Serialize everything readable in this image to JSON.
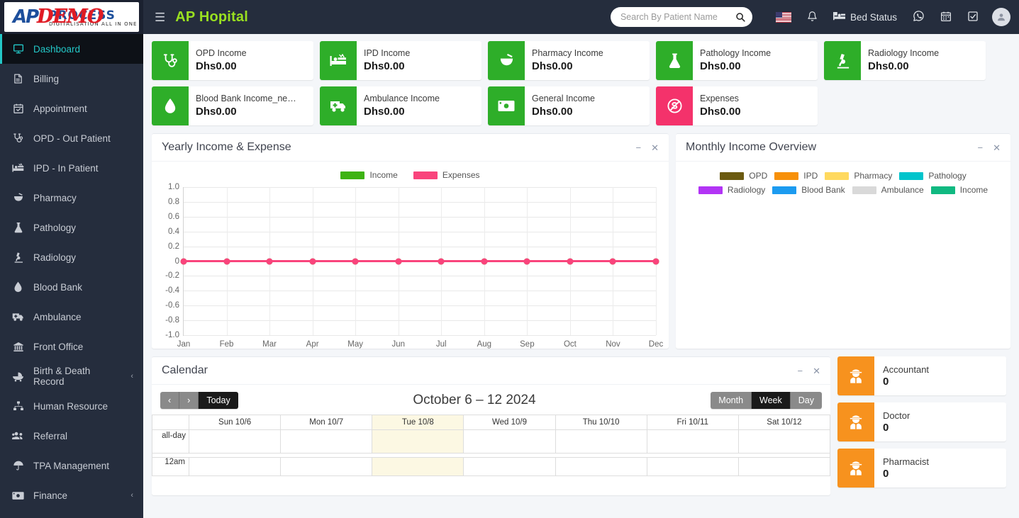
{
  "header": {
    "logo": {
      "ap": "AP",
      "process": "PROCESS",
      "subtitle": "DIGITALISATION ALL IN ONE",
      "demo": "DEMO"
    },
    "menu_toggle": "☰",
    "brand_title": "AP Hopital",
    "search": {
      "placeholder": "Search By Patient Name",
      "value": ""
    },
    "bed_status_label": "Bed Status",
    "icons": [
      "us-flag-icon",
      "bell-icon",
      "bed-icon",
      "whatsapp-icon",
      "calendar-icon",
      "checkbox-icon",
      "avatar"
    ]
  },
  "sidebar": {
    "items": [
      {
        "label": "Dashboard",
        "icon": "monitor-icon",
        "active": true,
        "chevron": ""
      },
      {
        "label": "Billing",
        "icon": "file-invoice-icon",
        "active": false,
        "chevron": ""
      },
      {
        "label": "Appointment",
        "icon": "calendar-check-icon",
        "active": false,
        "chevron": ""
      },
      {
        "label": "OPD - Out Patient",
        "icon": "stethoscope-icon",
        "active": false,
        "chevron": ""
      },
      {
        "label": "IPD - In Patient",
        "icon": "hospital-bed-icon",
        "active": false,
        "chevron": ""
      },
      {
        "label": "Pharmacy",
        "icon": "mortar-pestle-icon",
        "active": false,
        "chevron": ""
      },
      {
        "label": "Pathology",
        "icon": "flask-icon",
        "active": false,
        "chevron": ""
      },
      {
        "label": "Radiology",
        "icon": "microscope-icon",
        "active": false,
        "chevron": ""
      },
      {
        "label": "Blood Bank",
        "icon": "blood-drop-icon",
        "active": false,
        "chevron": ""
      },
      {
        "label": "Ambulance",
        "icon": "ambulance-icon",
        "active": false,
        "chevron": ""
      },
      {
        "label": "Front Office",
        "icon": "building-icon",
        "active": false,
        "chevron": ""
      },
      {
        "label": "Birth & Death Record",
        "icon": "baby-carriage-icon",
        "active": false,
        "chevron": "‹"
      },
      {
        "label": "Human Resource",
        "icon": "sitemap-icon",
        "active": false,
        "chevron": ""
      },
      {
        "label": "Referral",
        "icon": "users-icon",
        "active": false,
        "chevron": ""
      },
      {
        "label": "TPA Management",
        "icon": "umbrella-icon",
        "active": false,
        "chevron": ""
      },
      {
        "label": "Finance",
        "icon": "money-bill-icon",
        "active": false,
        "chevron": "‹"
      }
    ]
  },
  "stats": [
    {
      "label": "OPD Income",
      "value": "Dhs0.00",
      "icon": "stethoscope-icon",
      "color": "#2eae29"
    },
    {
      "label": "IPD Income",
      "value": "Dhs0.00",
      "icon": "hospital-bed-icon",
      "color": "#2eae29"
    },
    {
      "label": "Pharmacy Income",
      "value": "Dhs0.00",
      "icon": "mortar-pestle-icon",
      "color": "#2eae29"
    },
    {
      "label": "Pathology Income",
      "value": "Dhs0.00",
      "icon": "flask-icon",
      "color": "#2eae29"
    },
    {
      "label": "Radiology Income",
      "value": "Dhs0.00",
      "icon": "microscope-icon",
      "color": "#2eae29"
    },
    {
      "label": "Blood Bank Income_ne…",
      "value": "Dhs0.00",
      "icon": "blood-drop-icon",
      "color": "#2eae29"
    },
    {
      "label": "Ambulance Income",
      "value": "Dhs0.00",
      "icon": "ambulance-icon",
      "color": "#2eae29"
    },
    {
      "label": "General Income",
      "value": "Dhs0.00",
      "icon": "money-bill-icon",
      "color": "#2eae29"
    },
    {
      "label": "Expenses",
      "value": "Dhs0.00",
      "icon": "expense-icon",
      "color": "#f4326b"
    }
  ],
  "panels": {
    "yearly": {
      "title": "Yearly Income & Expense",
      "minimize": "−",
      "close": "✕"
    },
    "monthly": {
      "title": "Monthly Income Overview",
      "minimize": "−",
      "close": "✕"
    },
    "calendar": {
      "title": "Calendar",
      "minimize": "−",
      "close": "✕"
    }
  },
  "chart_data": [
    {
      "type": "line",
      "title": "Yearly Income & Expense",
      "categories": [
        "Jan",
        "Feb",
        "Mar",
        "Apr",
        "May",
        "Jun",
        "Jul",
        "Aug",
        "Sep",
        "Oct",
        "Nov",
        "Dec"
      ],
      "series": [
        {
          "name": "Income",
          "color": "#3eb313",
          "values": [
            0,
            0,
            0,
            0,
            0,
            0,
            0,
            0,
            0,
            0,
            0,
            0
          ]
        },
        {
          "name": "Expenses",
          "color": "#f9447c",
          "values": [
            0,
            0,
            0,
            0,
            0,
            0,
            0,
            0,
            0,
            0,
            0,
            0
          ]
        }
      ],
      "yticks": [
        "1.0",
        "0.8",
        "0.6",
        "0.4",
        "0.2",
        "0",
        "-0.2",
        "-0.4",
        "-0.6",
        "-0.8",
        "-1.0"
      ],
      "ylim": [
        -1.0,
        1.0
      ],
      "xlabel": "",
      "ylabel": "",
      "grid": true,
      "legend_position": "top"
    },
    {
      "type": "pie",
      "title": "Monthly Income Overview",
      "empty": true,
      "categories": [
        "OPD",
        "IPD",
        "Pharmacy",
        "Pathology",
        "Radiology",
        "Blood Bank",
        "Ambulance",
        "Income"
      ],
      "values": [
        0,
        0,
        0,
        0,
        0,
        0,
        0,
        0
      ],
      "colors": [
        "#6b5a10",
        "#f79009",
        "#ffd95e",
        "#00c4cc",
        "#b234f5",
        "#1c9bf0",
        "#d9d9d9",
        "#10b981"
      ],
      "legend_position": "top"
    }
  ],
  "calendar": {
    "prev": "‹",
    "next": "›",
    "today_label": "Today",
    "title": "October 6 – 12 2024",
    "views": [
      {
        "label": "Month",
        "active": false
      },
      {
        "label": "Week",
        "active": true
      },
      {
        "label": "Day",
        "active": false
      }
    ],
    "days": [
      {
        "label": "Sun 10/6",
        "today": false
      },
      {
        "label": "Mon 10/7",
        "today": false
      },
      {
        "label": "Tue 10/8",
        "today": true
      },
      {
        "label": "Wed 10/9",
        "today": false
      },
      {
        "label": "Thu 10/10",
        "today": false
      },
      {
        "label": "Fri 10/11",
        "today": false
      },
      {
        "label": "Sat 10/12",
        "today": false
      }
    ],
    "allday_label": "all-day",
    "first_slot": "12am"
  },
  "staff": [
    {
      "label": "Accountant",
      "count": "0",
      "icon": "user-secret-icon"
    },
    {
      "label": "Doctor",
      "count": "0",
      "icon": "user-secret-icon"
    },
    {
      "label": "Pharmacist",
      "count": "0",
      "icon": "user-secret-icon"
    }
  ]
}
